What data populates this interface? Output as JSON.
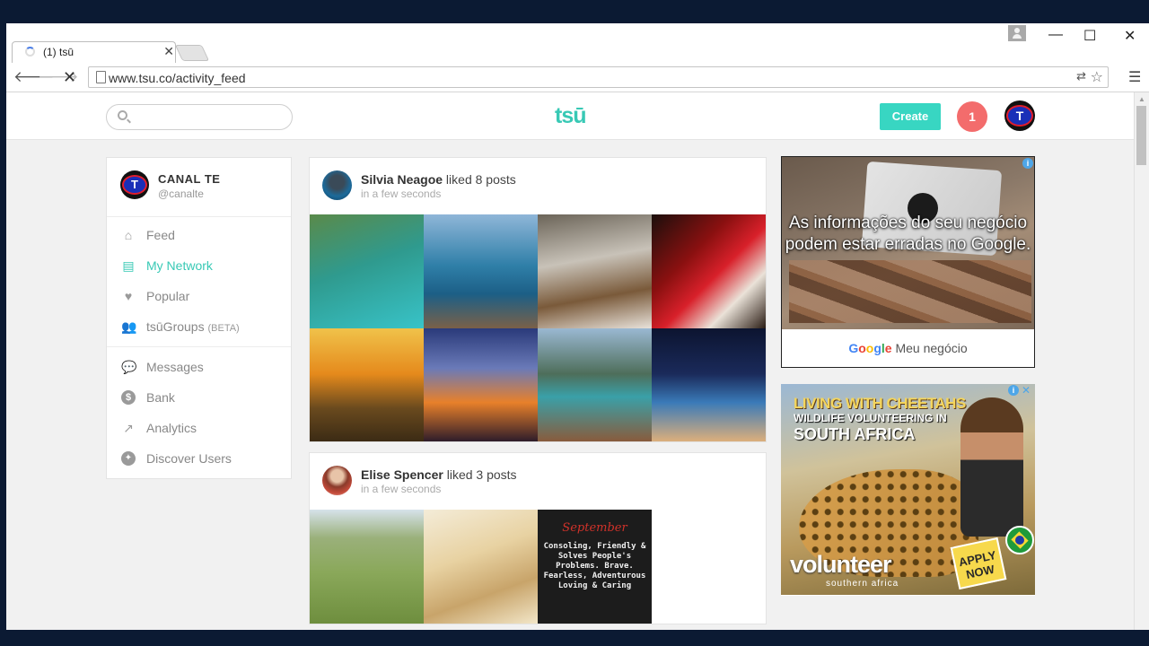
{
  "browser": {
    "tab_title": "(1) tsū",
    "url": "www.tsu.co/activity_feed",
    "window_controls": {
      "minimize": "—",
      "maximize": "☐",
      "close": "✕"
    }
  },
  "header": {
    "logo": "tsū",
    "search_placeholder": "",
    "create_label": "Create",
    "notification_count": "1",
    "avatar_letter": "T"
  },
  "sidebar": {
    "profile_name": "CANAL TE",
    "profile_handle": "@canalte",
    "items": [
      {
        "label": "Feed",
        "icon": "home-icon"
      },
      {
        "label": "My Network",
        "icon": "list-icon",
        "active": true
      },
      {
        "label": "Popular",
        "icon": "heart-icon"
      },
      {
        "label": "tsūGroups",
        "suffix": "(BETA)",
        "icon": "users-icon"
      },
      {
        "label": "Messages",
        "icon": "chat-icon"
      },
      {
        "label": "Bank",
        "icon": "dollar-icon"
      },
      {
        "label": "Analytics",
        "icon": "trend-icon"
      },
      {
        "label": "Discover Users",
        "icon": "compass-icon"
      }
    ]
  },
  "feed": [
    {
      "user": "Silvia Neagoe",
      "action": " liked 8 posts",
      "time": "in a few seconds",
      "thumbs": [
        "linear-gradient(160deg,#5a8a4a 0%,#2f9a8e 45%,#38c3c8 100%)",
        "linear-gradient(180deg,#8fb6d8 0%,#2f7fa8 45%,#1c5f86 70%,#7a6048 100%)",
        "linear-gradient(170deg,#6b6458 0%,#c8c2b8 40%,#7a5a3a 70%,#e8e2da 100%)",
        "linear-gradient(135deg,#1b0f0c 0%,#8a1010 35%,#d8202a 55%,#eae2d8 75%,#2a1c14 100%)",
        "linear-gradient(180deg,#f0c24a 0%,#e58a1c 40%,#6a4a1e 70%,#3a2a14 100%)",
        "linear-gradient(180deg,#2a3a7a 0%,#6a7ab8 35%,#e8802a 65%,#2a1a2a 100%)",
        "linear-gradient(180deg,#9ab8d2 0%,#4e6e5a 40%,#3aa0a8 60%,#8a5a3a 100%)",
        "linear-gradient(180deg,#0c1430 0%,#1a2a5a 40%,#3a7ab8 65%,#e0b07a 100%)"
      ]
    },
    {
      "user": "Elise Spencer",
      "action": " liked 3 posts",
      "time": "in a few seconds",
      "thumbs": [
        "linear-gradient(180deg,#d6e2ea 0%,#9ab07a 25%,#8aa85a 55%,#6e8e3e 100%)",
        "linear-gradient(160deg,#f4ecd8 0%,#e8d2a2 40%,#c8a46a 70%,#f2e6c8 100%)"
      ],
      "text_card": {
        "heading": "September",
        "body": "Consoling, Friendly & Solves People's Problems. Brave. Fearless, Adventurous Loving & Caring"
      }
    }
  ],
  "ads": {
    "ad1": {
      "headline": "As informações do seu negócio podem estar erradas no Google.",
      "brand_g": "Google",
      "brand_rest": " Meu negócio",
      "colors": [
        "#4285F4",
        "#EA4335",
        "#FBBC05",
        "#4285F4",
        "#34A853",
        "#EA4335"
      ]
    },
    "ad2": {
      "line1": "LIVING WITH CHEETAHS",
      "line2": "WILDLIFE VOLUNTEERING IN",
      "line3": "SOUTH AFRICA",
      "brand": "volunteer",
      "brand_sub": "southern africa",
      "cta": "APPLY NOW"
    }
  }
}
